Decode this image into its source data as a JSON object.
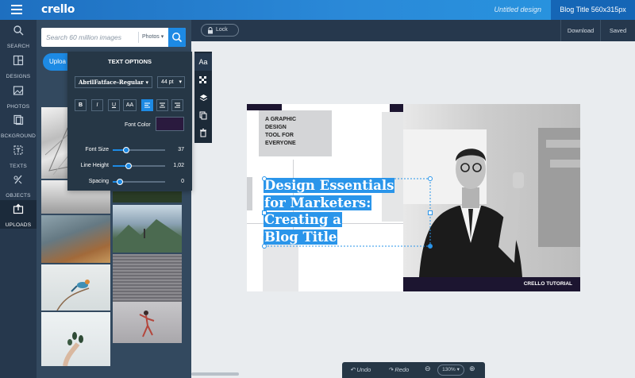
{
  "app": {
    "logo": "crello",
    "doc_title": "Untitled design",
    "doc_size_label": "Blog Title 560x315px"
  },
  "rail": {
    "items": [
      {
        "label": "SEARCH",
        "icon": "search-icon"
      },
      {
        "label": "DESIGNS",
        "icon": "designs-icon"
      },
      {
        "label": "PHOTOS",
        "icon": "photos-icon"
      },
      {
        "label": "BCKGROUND",
        "icon": "background-icon"
      },
      {
        "label": "TEXTS",
        "icon": "texts-icon"
      },
      {
        "label": "OBJECTS",
        "icon": "objects-icon"
      },
      {
        "label": "UPLOADS",
        "icon": "uploads-icon"
      }
    ],
    "active_item": "UPLOADS"
  },
  "panel": {
    "search_placeholder": "Search 60 million images",
    "search_scope": "Photos",
    "active_tab": "Uploa"
  },
  "text_options": {
    "title": "TEXT OPTIONS",
    "font_family": "AbrilFatface-Regular",
    "font_size": "44 pt",
    "format_buttons": [
      "B",
      "I",
      "U",
      "AA"
    ],
    "align_active": "left",
    "font_color_label": "Font Color",
    "font_color": "#2a1a3e",
    "sliders": [
      {
        "label": "Font Size",
        "value": "37",
        "fraction": 0.25
      },
      {
        "label": "Line Height",
        "value": "1,02",
        "fraction": 0.3
      },
      {
        "label": "Spacing",
        "value": "0",
        "fraction": 0.13
      }
    ]
  },
  "vtoolbar": {
    "items": [
      "Aa",
      "texture-icon",
      "layers-icon",
      "copy-icon",
      "trash-icon"
    ]
  },
  "canvas_head": {
    "lock_label": "Lock",
    "download_label": "Download",
    "saved_label": "Saved"
  },
  "artboard": {
    "tagline": [
      "A GRAPHIC",
      "DESIGN",
      "TOOL FOR",
      "EVERYONE"
    ],
    "headline": [
      "Design Essentials",
      "for Marketers:",
      "Creating a",
      "Blog Title"
    ],
    "footer": "CRELLO TUTORIAL",
    "accent": "#2a95ea"
  },
  "bottom": {
    "undo": "Undo",
    "redo": "Redo",
    "zoom": "130%"
  }
}
